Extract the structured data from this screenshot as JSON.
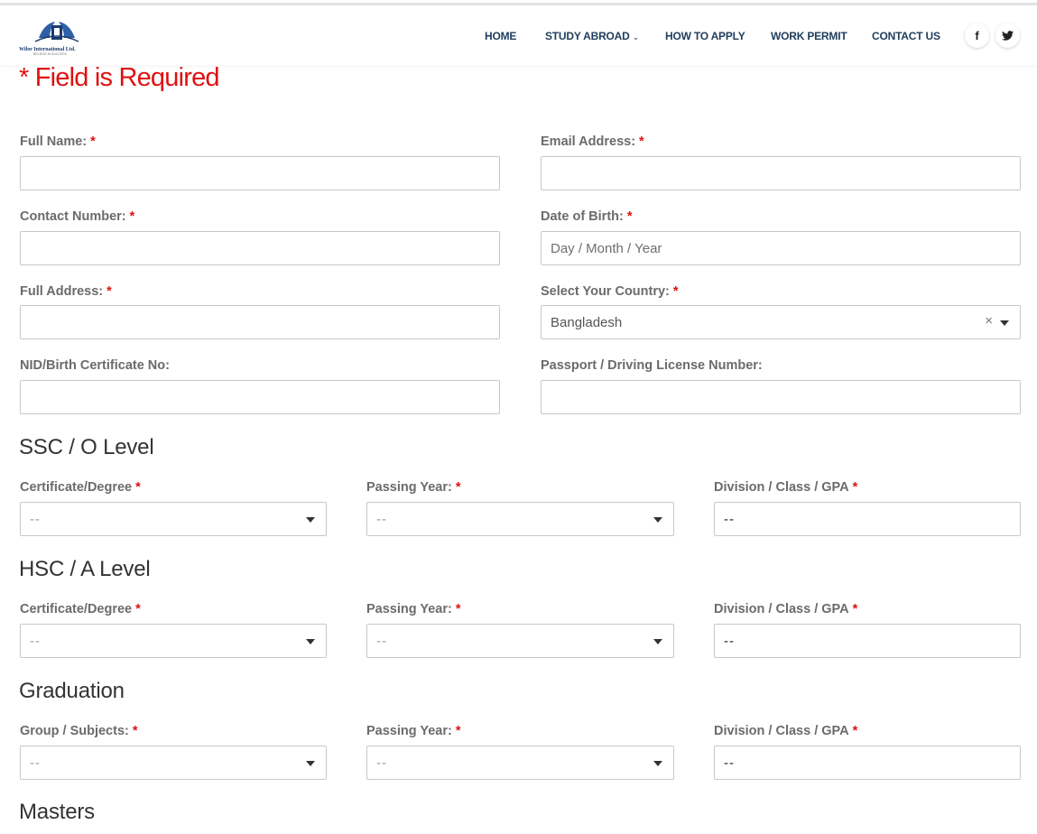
{
  "header": {
    "logo": {
      "name": "Wilor International Ltd.",
      "tagline": "BELIEVE IN SUCCESS"
    },
    "nav": [
      {
        "label": "HOME"
      },
      {
        "label": "STUDY ABROAD",
        "has_dropdown": true
      },
      {
        "label": "HOW TO APPLY"
      },
      {
        "label": "WORK PERMIT"
      },
      {
        "label": "CONTACT US"
      }
    ],
    "social": [
      {
        "icon": "facebook-icon",
        "glyph": "f"
      },
      {
        "icon": "twitter-icon",
        "glyph": "🐦"
      }
    ]
  },
  "form": {
    "required_note": "* Field is Required",
    "required_star": "*",
    "full_name": {
      "label": "Full Name:",
      "value": ""
    },
    "email": {
      "label": "Email Address:",
      "value": ""
    },
    "contact": {
      "label": "Contact Number:",
      "value": ""
    },
    "dob": {
      "label": "Date of Birth:",
      "placeholder": "Day / Month / Year"
    },
    "address": {
      "label": "Full Address:",
      "value": ""
    },
    "country": {
      "label": "Select Your Country:",
      "value": "Bangladesh",
      "clear": "×"
    },
    "nid": {
      "label": "NID/Birth Certificate No:",
      "value": ""
    },
    "passport": {
      "label": "Passport / Driving License Number:",
      "value": ""
    }
  },
  "sections": {
    "ssc": {
      "title": "SSC / O Level",
      "certificate": {
        "label": "Certificate/Degree",
        "value": "--"
      },
      "year": {
        "label": "Passing Year:",
        "value": "--"
      },
      "gpa": {
        "label": "Division / Class / GPA",
        "value": "--"
      }
    },
    "hsc": {
      "title": "HSC / A Level",
      "certificate": {
        "label": "Certificate/Degree",
        "value": "--"
      },
      "year": {
        "label": "Passing Year:",
        "value": "--"
      },
      "gpa": {
        "label": "Division / Class / GPA",
        "value": "--"
      }
    },
    "graduation": {
      "title": "Graduation",
      "group": {
        "label": "Group / Subjects:",
        "value": "--"
      },
      "year": {
        "label": "Passing Year:",
        "value": "--"
      },
      "gpa": {
        "label": "Division / Class / GPA",
        "value": "--"
      }
    },
    "masters": {
      "title": "Masters"
    }
  },
  "colors": {
    "required": "#e01010",
    "nav": "#1f3d5c",
    "brand": "#1d3b6e"
  }
}
